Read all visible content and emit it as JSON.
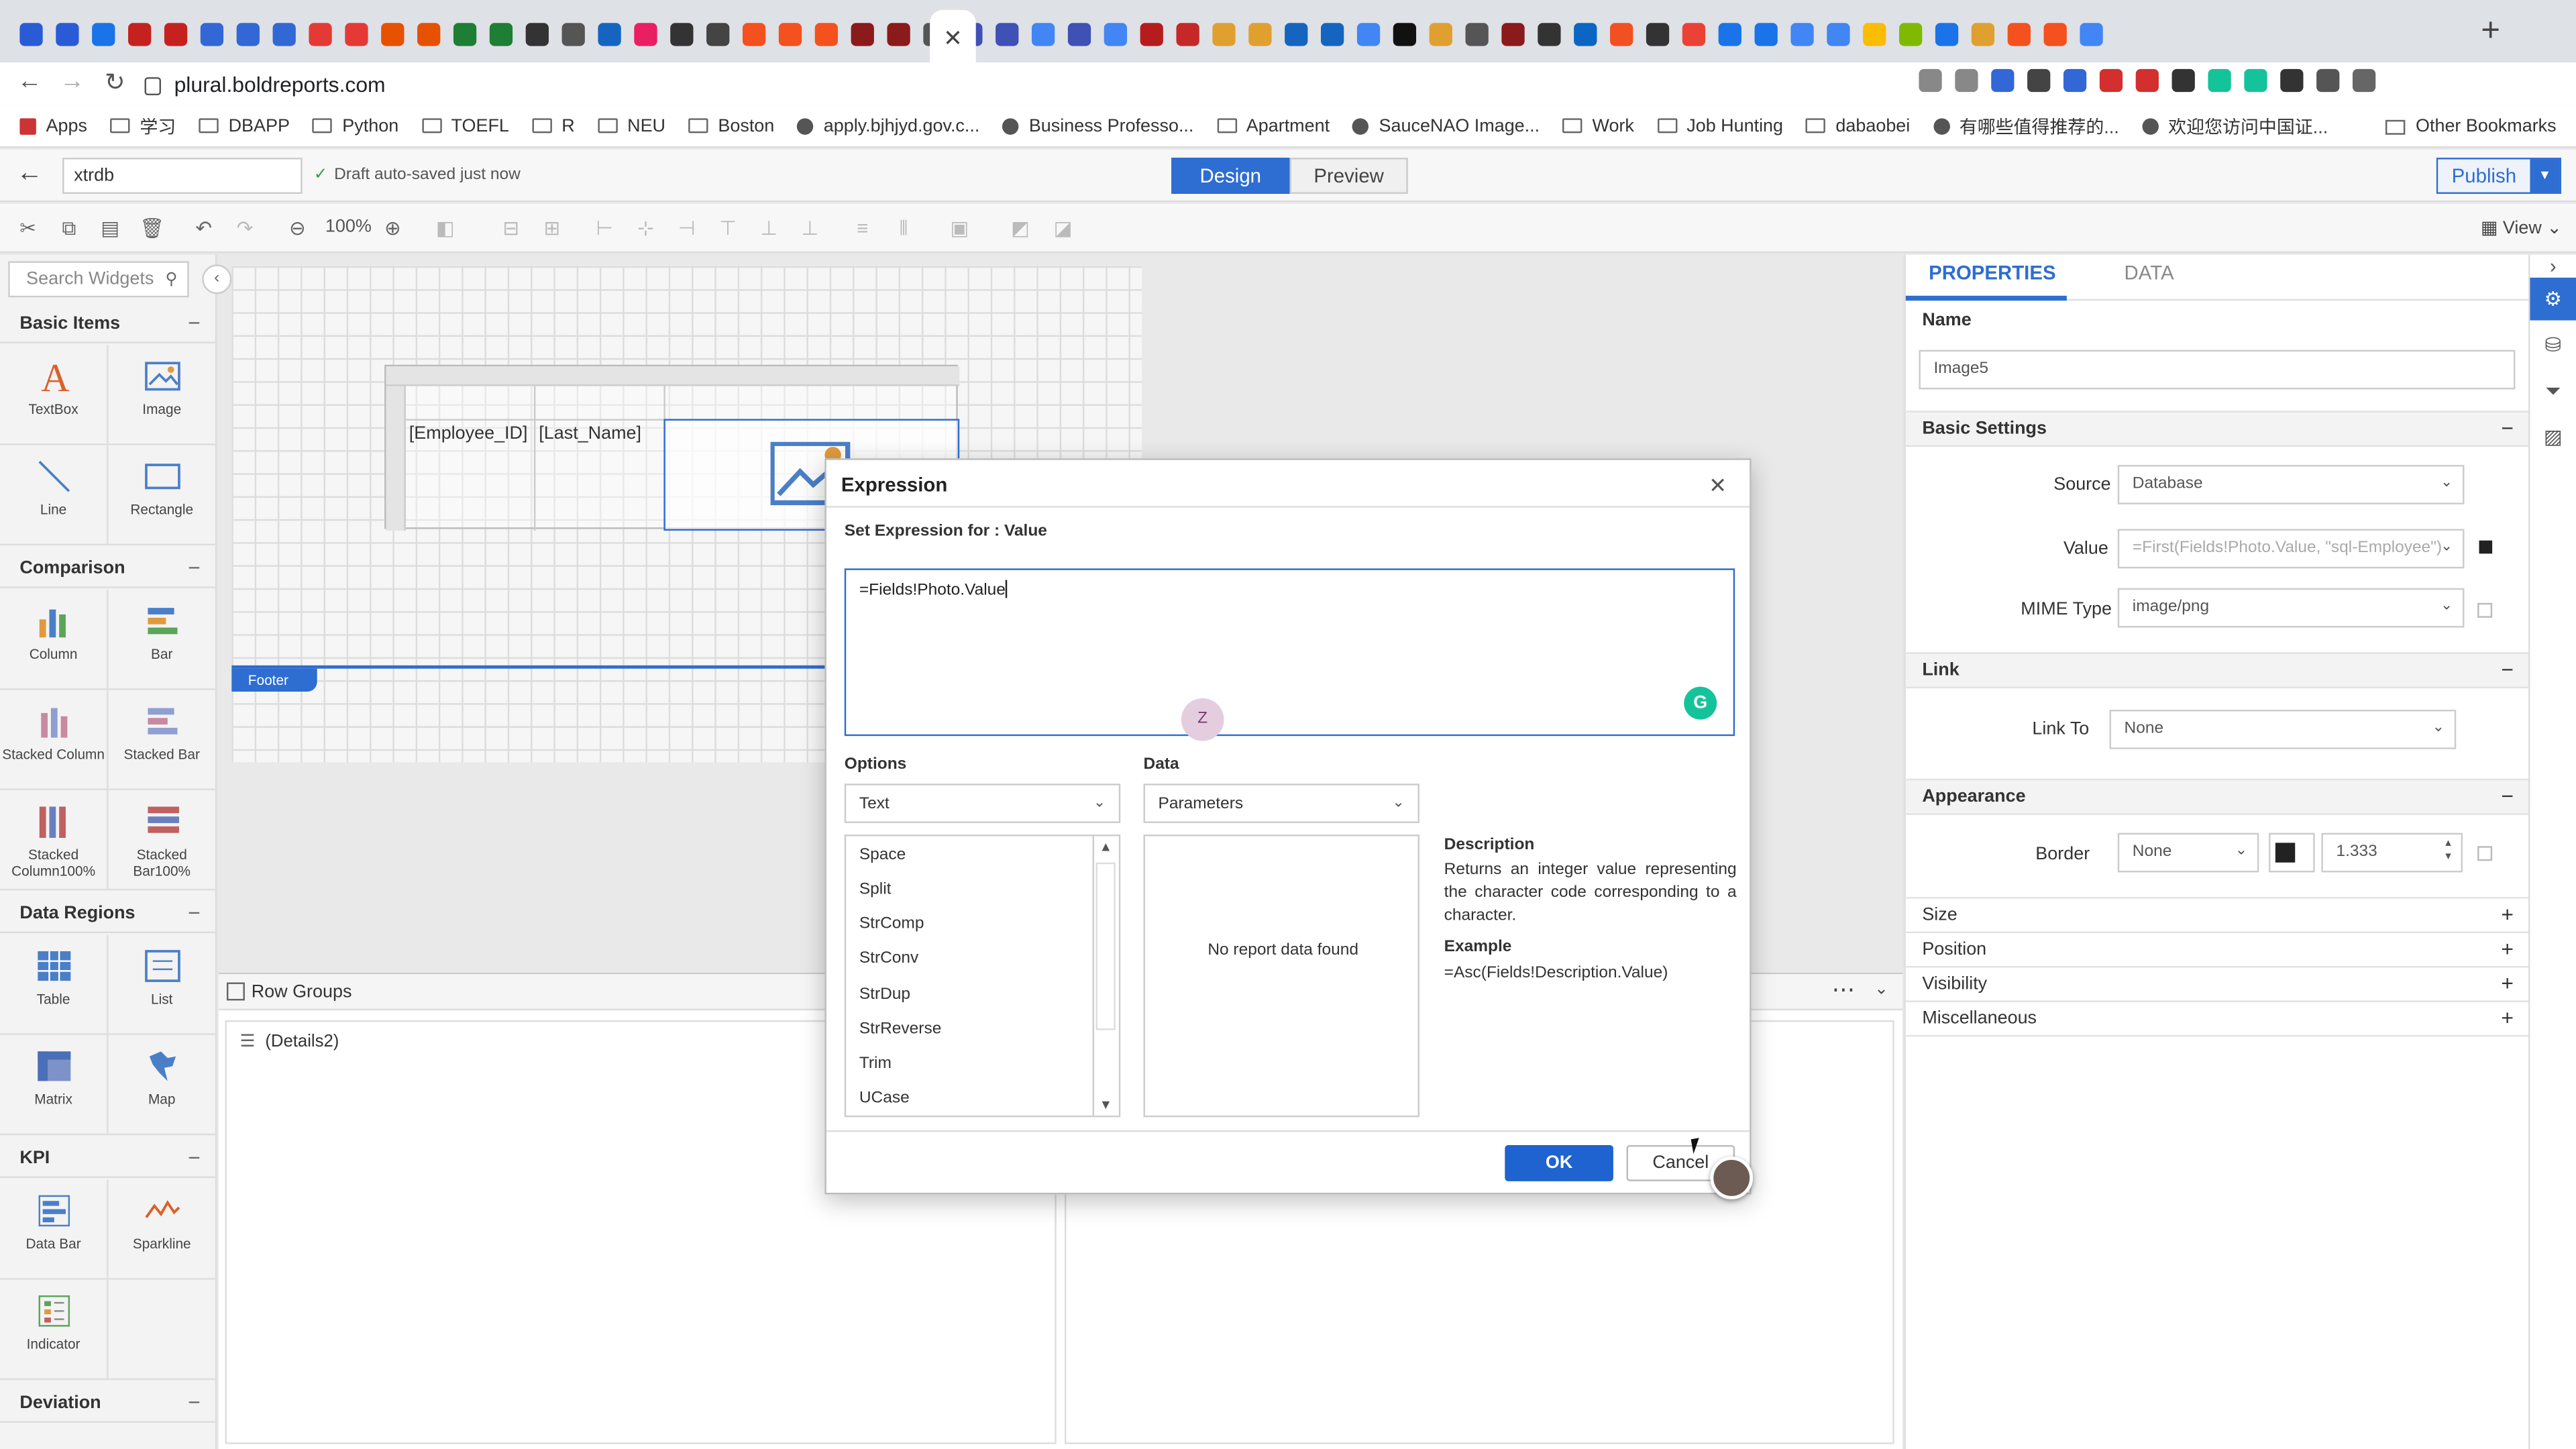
{
  "browser": {
    "url": "plural.boldreports.com",
    "bookmarks": [
      {
        "label": "Apps",
        "type": "apps"
      },
      {
        "label": "学习",
        "type": "folder"
      },
      {
        "label": "DBAPP",
        "type": "folder"
      },
      {
        "label": "Python",
        "type": "folder"
      },
      {
        "label": "TOEFL",
        "type": "folder"
      },
      {
        "label": "R",
        "type": "folder"
      },
      {
        "label": "NEU",
        "type": "folder"
      },
      {
        "label": "Boston",
        "type": "folder"
      },
      {
        "label": "apply.bjhjyd.gov.c...",
        "type": "site"
      },
      {
        "label": "Business Professo...",
        "type": "site"
      },
      {
        "label": "Apartment",
        "type": "folder"
      },
      {
        "label": "SauceNAO Image...",
        "type": "site"
      },
      {
        "label": "Work",
        "type": "folder"
      },
      {
        "label": "Job Hunting",
        "type": "folder"
      },
      {
        "label": "dabaobei",
        "type": "folder"
      },
      {
        "label": "有哪些值得推荐的...",
        "type": "site"
      },
      {
        "label": "欢迎您访问中国证...",
        "type": "site"
      }
    ],
    "other_bookmarks": "Other Bookmarks",
    "active_tab_close": "✕",
    "new_tab": "+"
  },
  "app": {
    "report_name": "xtrdb",
    "autosave": "Draft auto-saved just now",
    "mode_design": "Design",
    "mode_preview": "Preview",
    "publish": "Publish",
    "zoom": "100%",
    "view": "View"
  },
  "widgets": {
    "search_placeholder": "Search Widgets",
    "categories": {
      "basic": "Basic Items",
      "comparison": "Comparison",
      "data_regions": "Data Regions",
      "kpi": "KPI",
      "deviation": "Deviation"
    },
    "basic_items": [
      "TextBox",
      "Image",
      "Line",
      "Rectangle"
    ],
    "comparison_items": [
      "Column",
      "Bar",
      "Stacked Column",
      "Stacked Bar",
      "Stacked Column100%",
      "Stacked Bar100%"
    ],
    "data_region_items": [
      "Table",
      "List",
      "Matrix",
      "Map"
    ],
    "kpi_items": [
      "Data Bar",
      "Sparkline",
      "Indicator"
    ]
  },
  "canvas": {
    "cell_employee": "[Employee_ID]",
    "cell_lastname": "[Last_Name]",
    "footer": "Footer"
  },
  "row_groups": {
    "title": "Row Groups",
    "detail": "(Details2)"
  },
  "properties": {
    "tab_properties": "PROPERTIES",
    "tab_data": "DATA",
    "name_label": "Name",
    "name_value": "Image5",
    "basic_settings": "Basic Settings",
    "source_label": "Source",
    "source_value": "Database",
    "value_label": "Value",
    "value_value": "=First(Fields!Photo.Value, \"sql-Employee\")",
    "mime_label": "MIME Type",
    "mime_value": "image/png",
    "link": "Link",
    "link_to_label": "Link To",
    "link_to_value": "None",
    "appearance": "Appearance",
    "border_label": "Border",
    "border_value": "None",
    "border_width": "1.333",
    "size": "Size",
    "position": "Position",
    "visibility": "Visibility",
    "misc": "Miscellaneous"
  },
  "dialog": {
    "title": "Expression",
    "subtitle": "Set Expression for : Value",
    "expression": "=Fields!Photo.Value",
    "options_label": "Options",
    "options_value": "Text",
    "data_label": "Data",
    "data_value": "Parameters",
    "functions": [
      "Space",
      "Split",
      "StrComp",
      "StrConv",
      "StrDup",
      "StrReverse",
      "Trim",
      "UCase"
    ],
    "no_data": "No report data found",
    "description_label": "Description",
    "description": "Returns an integer value representing the character code corresponding to a character.",
    "example_label": "Example",
    "example": "=Asc(Fields!Description.Value)",
    "ok": "OK",
    "cancel": "Cancel",
    "zoom_badge": "Z"
  }
}
